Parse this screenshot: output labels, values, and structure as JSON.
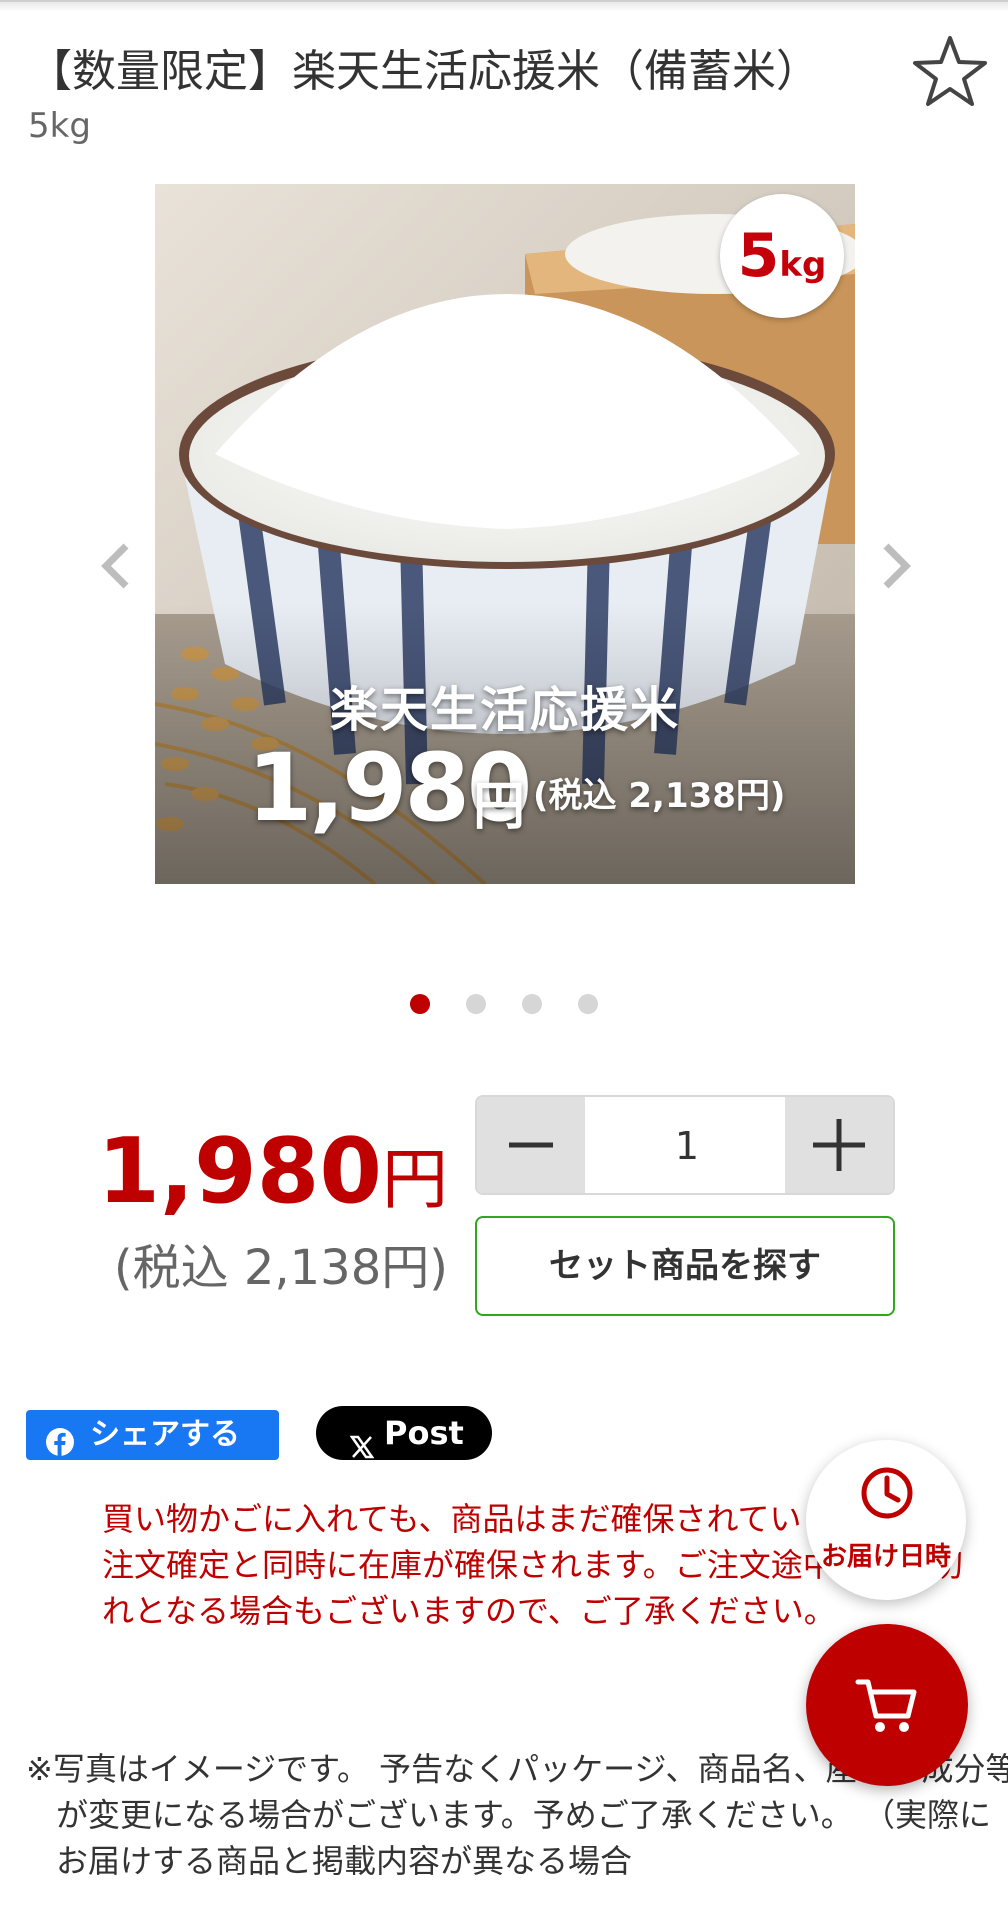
{
  "product": {
    "title": "【数量限定】楽天生活応援米（備蓄米）",
    "subtitle": "5kg"
  },
  "image": {
    "overlay_title": "楽天生活応援米",
    "overlay_price": "1,980",
    "overlay_yen": "円",
    "overlay_tax": "(税込 2,138円)",
    "badge_number": "5",
    "badge_unit": "kg",
    "slide_count": 4,
    "active_slide": 1
  },
  "price": {
    "amount": "1,980",
    "yen": "円",
    "tax_included": "(税込 2,138円)"
  },
  "quantity": {
    "value": "1"
  },
  "buttons": {
    "set_search": "セット商品を探す",
    "facebook_share": "シェアする",
    "x_post": "Post"
  },
  "notice": "買い物かごに入れても、商品はまだ確保されていません。ご注文確定と同時に在庫が確保されます。ご注文途中に在庫切れとなる場合もございますので、ご了承ください。",
  "disclaimer": "※写真はイメージです。 予告なくパッケージ、商品名、産地、成分等が変更になる場合がございます。予めご了承ください。 （実際にお届けする商品と掲載内容が異なる場合",
  "fab": {
    "delivery_label": "お届け日時"
  },
  "colors": {
    "accent_red": "#bf0000",
    "set_button_border": "#33a51f",
    "facebook_blue": "#1877f2",
    "x_black": "#000000"
  }
}
